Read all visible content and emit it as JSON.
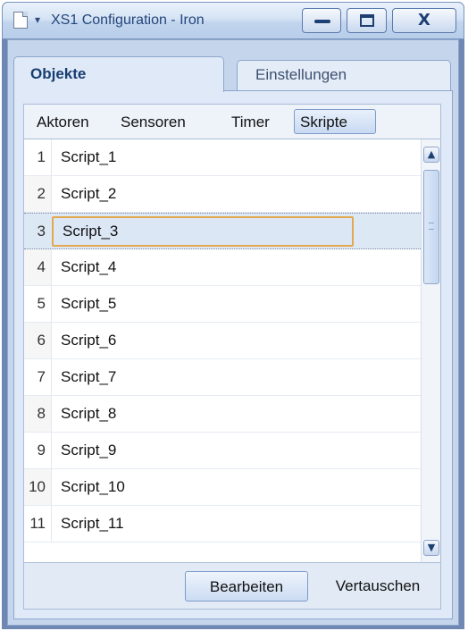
{
  "window": {
    "title": "XS1 Configuration - Iron",
    "sysmenu_icon": "document-icon",
    "controls": {
      "minimize": "minimize-icon",
      "maximize": "maximize-icon",
      "close": "close-icon",
      "close_glyph": "X"
    }
  },
  "tabs": [
    {
      "label": "Objekte",
      "active": true
    },
    {
      "label": "Einstellungen",
      "active": false
    }
  ],
  "subtabs": [
    {
      "label": "Aktoren",
      "selected": false
    },
    {
      "label": "Sensoren",
      "selected": false
    },
    {
      "label": "Timer",
      "selected": false
    },
    {
      "label": "Skripte",
      "selected": true
    }
  ],
  "list": {
    "rows": [
      {
        "num": "1",
        "name": "Script_1"
      },
      {
        "num": "2",
        "name": "Script_2"
      },
      {
        "num": "3",
        "name": "Script_3",
        "selected": true
      },
      {
        "num": "4",
        "name": "Script_4"
      },
      {
        "num": "5",
        "name": "Script_5"
      },
      {
        "num": "6",
        "name": "Script_6"
      },
      {
        "num": "7",
        "name": "Script_7"
      },
      {
        "num": "8",
        "name": "Script_8"
      },
      {
        "num": "9",
        "name": "Script_9"
      },
      {
        "num": "10",
        "name": "Script_10"
      },
      {
        "num": "11",
        "name": "Script_11"
      }
    ]
  },
  "footer": {
    "edit_label": "Bearbeiten",
    "swap_label": "Vertauschen"
  },
  "colors": {
    "accent": "#e3a84f",
    "title_text": "#24467b",
    "panel_bg": "#dfe9f7"
  }
}
